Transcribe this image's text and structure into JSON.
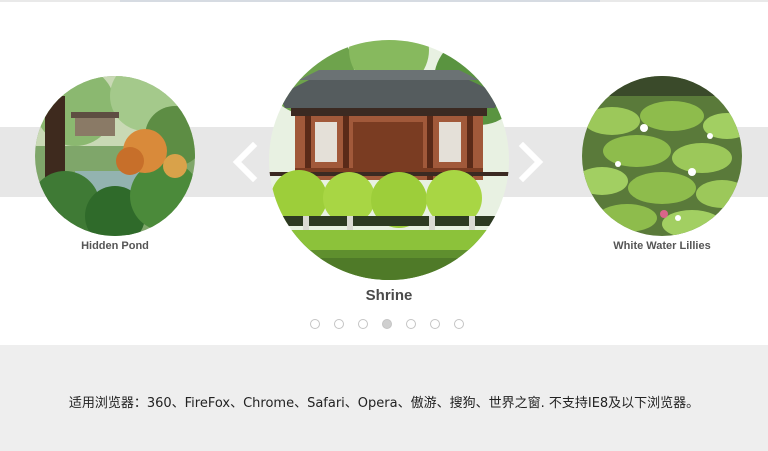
{
  "carousel": {
    "slides": [
      {
        "caption": "Hidden Pond"
      },
      {
        "caption": "Shrine"
      },
      {
        "caption": "White Water Lillies"
      }
    ],
    "prev_icon": "chevron-left-icon",
    "next_icon": "chevron-right-icon",
    "pagination": {
      "count": 7,
      "active_index": 3
    }
  },
  "footer": {
    "note": "适用浏览器：360、FireFox、Chrome、Safari、Opera、傲游、搜狗、世界之窗. 不支持IE8及以下浏览器。"
  },
  "colors": {
    "band": "#e7e7e7",
    "footer_bg": "#eeeeee",
    "caption": "#555555",
    "arrow": "#ffffff"
  }
}
